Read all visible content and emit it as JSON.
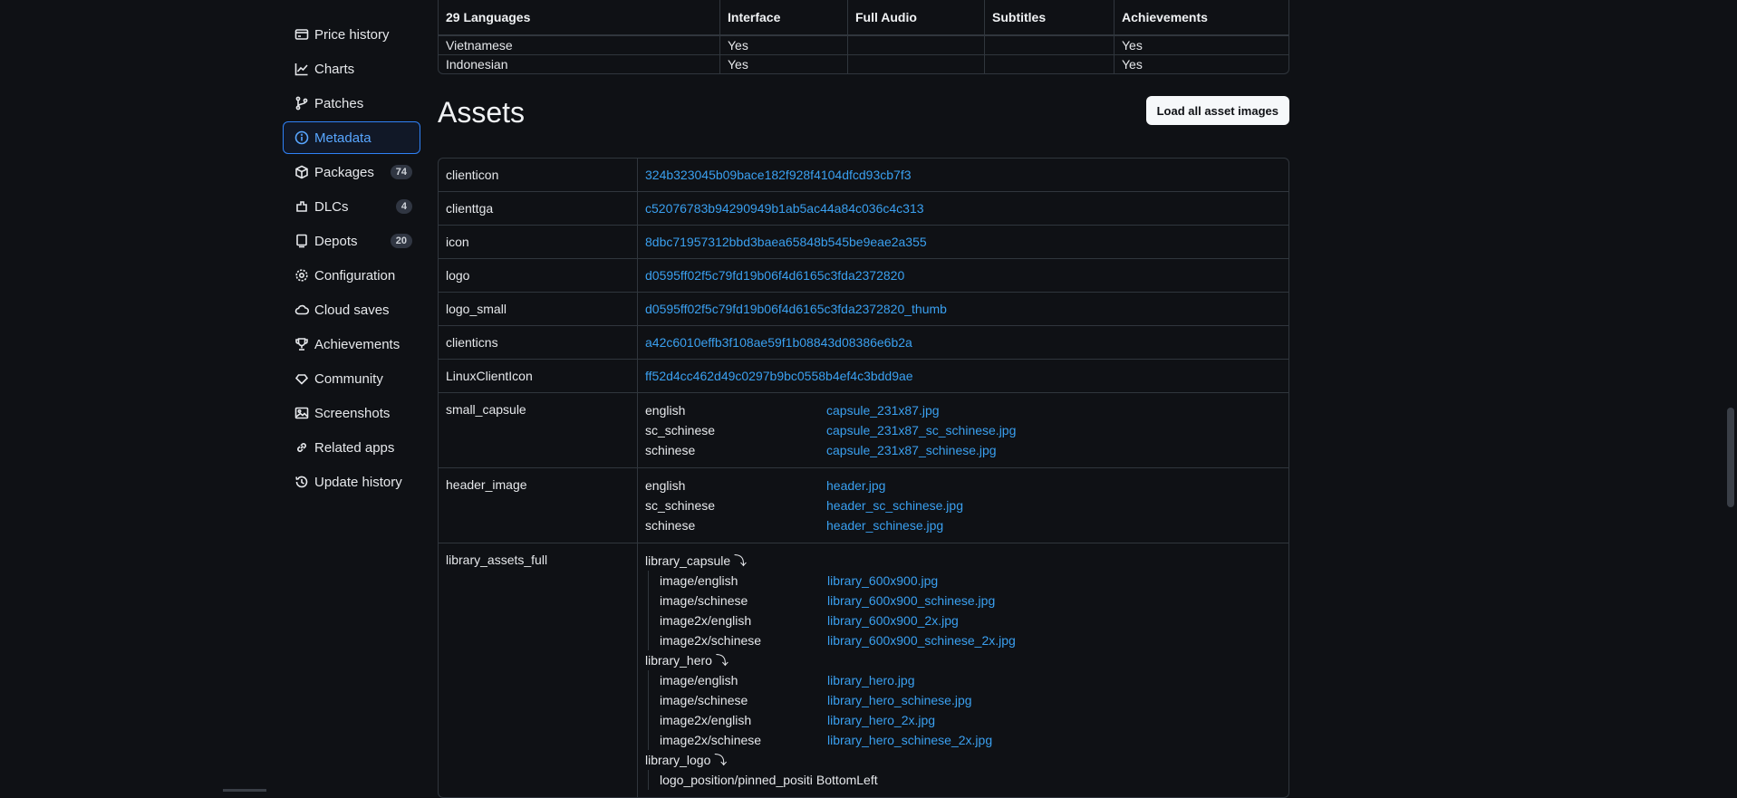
{
  "sidebar": {
    "items": [
      {
        "label": "Price history",
        "icon": "price-history-icon"
      },
      {
        "label": "Charts",
        "icon": "chart-icon"
      },
      {
        "label": "Patches",
        "icon": "git-branch-icon"
      },
      {
        "label": "Metadata",
        "icon": "info-icon",
        "active": true
      },
      {
        "label": "Packages",
        "icon": "package-icon",
        "badge": "74"
      },
      {
        "label": "DLCs",
        "icon": "dlc-icon",
        "badge": "4"
      },
      {
        "label": "Depots",
        "icon": "depot-icon",
        "badge": "20"
      },
      {
        "label": "Configuration",
        "icon": "gear-icon"
      },
      {
        "label": "Cloud saves",
        "icon": "cloud-icon"
      },
      {
        "label": "Achievements",
        "icon": "trophy-icon"
      },
      {
        "label": "Community",
        "icon": "community-icon"
      },
      {
        "label": "Screenshots",
        "icon": "image-icon"
      },
      {
        "label": "Related apps",
        "icon": "link-icon"
      },
      {
        "label": "Update history",
        "icon": "history-icon"
      }
    ]
  },
  "languages": {
    "headers": [
      "29 Languages",
      "Interface",
      "Full Audio",
      "Subtitles",
      "Achievements"
    ],
    "rows": [
      [
        "Vietnamese",
        "Yes",
        "",
        "",
        "Yes"
      ],
      [
        "Indonesian",
        "Yes",
        "",
        "",
        "Yes"
      ]
    ]
  },
  "assets": {
    "title": "Assets",
    "load_button": "Load all asset images",
    "simple": [
      {
        "key": "clienticon",
        "value": "324b323045b09bace182f928f4104dfcd93cb7f3"
      },
      {
        "key": "clienttga",
        "value": "c52076783b94290949b1ab5ac44a84c036c4c313"
      },
      {
        "key": "icon",
        "value": "8dbc71957312bbd3baea65848b545be9eae2a355"
      },
      {
        "key": "logo",
        "value": "d0595ff02f5c79fd19b06f4d6165c3fda2372820"
      },
      {
        "key": "logo_small",
        "value": "d0595ff02f5c79fd19b06f4d6165c3fda2372820_thumb"
      },
      {
        "key": "clienticns",
        "value": "a42c6010effb3f108ae59f1b08843d08386e6b2a"
      },
      {
        "key": "LinuxClientIcon",
        "value": "ff52d4cc462d49c0297b9bc0558b4ef4c3bdd9ae"
      }
    ],
    "small_capsule": {
      "key": "small_capsule",
      "items": [
        {
          "k": "english",
          "v": "capsule_231x87.jpg"
        },
        {
          "k": "sc_schinese",
          "v": "capsule_231x87_sc_schinese.jpg"
        },
        {
          "k": "schinese",
          "v": "capsule_231x87_schinese.jpg"
        }
      ]
    },
    "header_image": {
      "key": "header_image",
      "items": [
        {
          "k": "english",
          "v": "header.jpg"
        },
        {
          "k": "sc_schinese",
          "v": "header_sc_schinese.jpg"
        },
        {
          "k": "schinese",
          "v": "header_schinese.jpg"
        }
      ]
    },
    "library_assets_full": {
      "key": "library_assets_full",
      "groups": [
        {
          "title": "library_capsule ⤵",
          "items": [
            {
              "k": "image/english",
              "v": "library_600x900.jpg"
            },
            {
              "k": "image/schinese",
              "v": "library_600x900_schinese.jpg"
            },
            {
              "k": "image2x/english",
              "v": "library_600x900_2x.jpg"
            },
            {
              "k": "image2x/schinese",
              "v": "library_600x900_schinese_2x.jpg"
            }
          ]
        },
        {
          "title": "library_hero ⤵",
          "items": [
            {
              "k": "image/english",
              "v": "library_hero.jpg"
            },
            {
              "k": "image/schinese",
              "v": "library_hero_schinese.jpg"
            },
            {
              "k": "image2x/english",
              "v": "library_hero_2x.jpg"
            },
            {
              "k": "image2x/schinese",
              "v": "library_hero_schinese_2x.jpg"
            }
          ]
        },
        {
          "title": "library_logo ⤵",
          "items": [
            {
              "k": "logo_position/pinned_positi",
              "v": "BottomLeft",
              "plain": true
            }
          ]
        }
      ]
    }
  }
}
